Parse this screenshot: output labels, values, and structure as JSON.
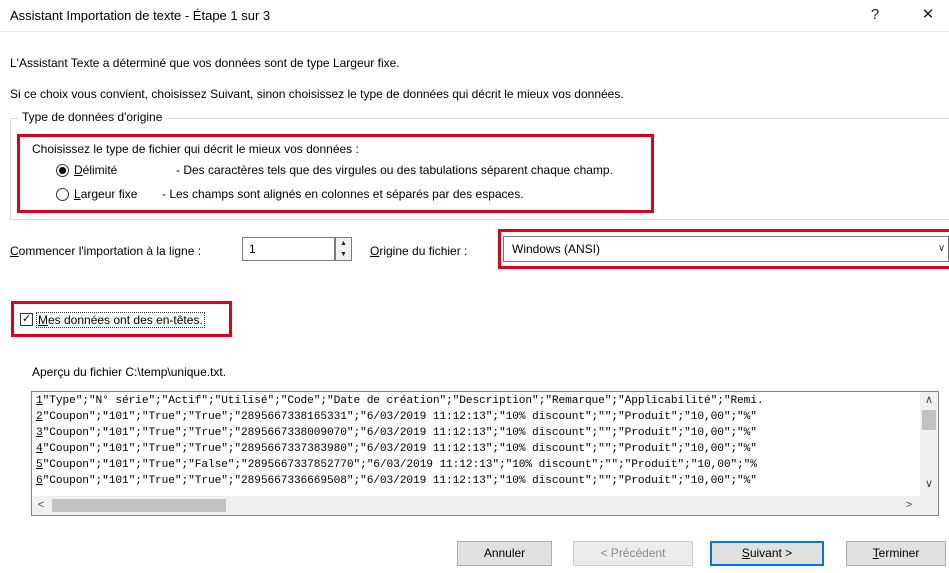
{
  "window": {
    "title": "Assistant Importation de texte - Étape 1 sur 3",
    "help_glyph": "?",
    "close_glyph": "✕"
  },
  "intro": {
    "line1": "L'Assistant Texte a déterminé que vos données sont de type Largeur fixe.",
    "line2": "Si ce choix vous convient, choisissez Suivant, sinon choisissez le type de données qui décrit le mieux vos données."
  },
  "group": {
    "title": "Type de données d'origine",
    "prompt": "Choisissez le type de fichier qui décrit le mieux vos données :",
    "options": [
      {
        "hot": "D",
        "rest": "élimité",
        "desc": "- Des caractères tels que des virgules ou des tabulations séparent chaque champ.",
        "selected": true
      },
      {
        "hot": "L",
        "rest": "argeur fixe",
        "desc": "- Les champs sont alignés en colonnes et séparés par des espaces.",
        "selected": false
      }
    ]
  },
  "import": {
    "start_hot": "C",
    "start_rest": "ommencer l'importation à la ligne :",
    "start_value": "1",
    "origin_hot": "O",
    "origin_rest": "rigine du fichier :",
    "origin_value": "Windows (ANSI)"
  },
  "headers_checkbox": {
    "hot": "M",
    "rest": "es données ont des en-têtes.",
    "checked": true
  },
  "preview": {
    "label": "Aperçu du fichier C:\\temp\\unique.txt.",
    "lines": [
      {
        "n": "1",
        "text": "\"Type\";\"N° série\";\"Actif\";\"Utilisé\";\"Code\";\"Date de création\";\"Description\";\"Remarque\";\"Applicabilité\";\"Remi."
      },
      {
        "n": "2",
        "text": "\"Coupon\";\"101\";\"True\";\"True\";\"2895667338165331\";\"6/03/2019 11:12:13\";\"10% discount\";\"\";\"Produit\";\"10,00\";\"%\""
      },
      {
        "n": "3",
        "text": "\"Coupon\";\"101\";\"True\";\"True\";\"2895667338009070\";\"6/03/2019 11:12:13\";\"10% discount\";\"\";\"Produit\";\"10,00\";\"%\""
      },
      {
        "n": "4",
        "text": "\"Coupon\";\"101\";\"True\";\"True\";\"2895667337383980\";\"6/03/2019 11:12:13\";\"10% discount\";\"\";\"Produit\";\"10,00\";\"%\""
      },
      {
        "n": "5",
        "text": "\"Coupon\";\"101\";\"True\";\"False\";\"2895667337852770\";\"6/03/2019 11:12:13\";\"10% discount\";\"\";\"Produit\";\"10,00\";\"%"
      },
      {
        "n": "6",
        "text": "\"Coupon\";\"101\";\"True\";\"True\";\"2895667336669508\";\"6/03/2019 11:12:13\";\"10% discount\";\"\";\"Produit\";\"10,00\";\"%\""
      }
    ]
  },
  "buttons": {
    "cancel": "Annuler",
    "previous": "< Précédent",
    "next_hot": "S",
    "next_rest": "uivant >",
    "finish_hot": "T",
    "finish_rest": "erminer"
  },
  "colors": {
    "highlight": "#e0001b",
    "default_button_border": "#0078d7"
  }
}
